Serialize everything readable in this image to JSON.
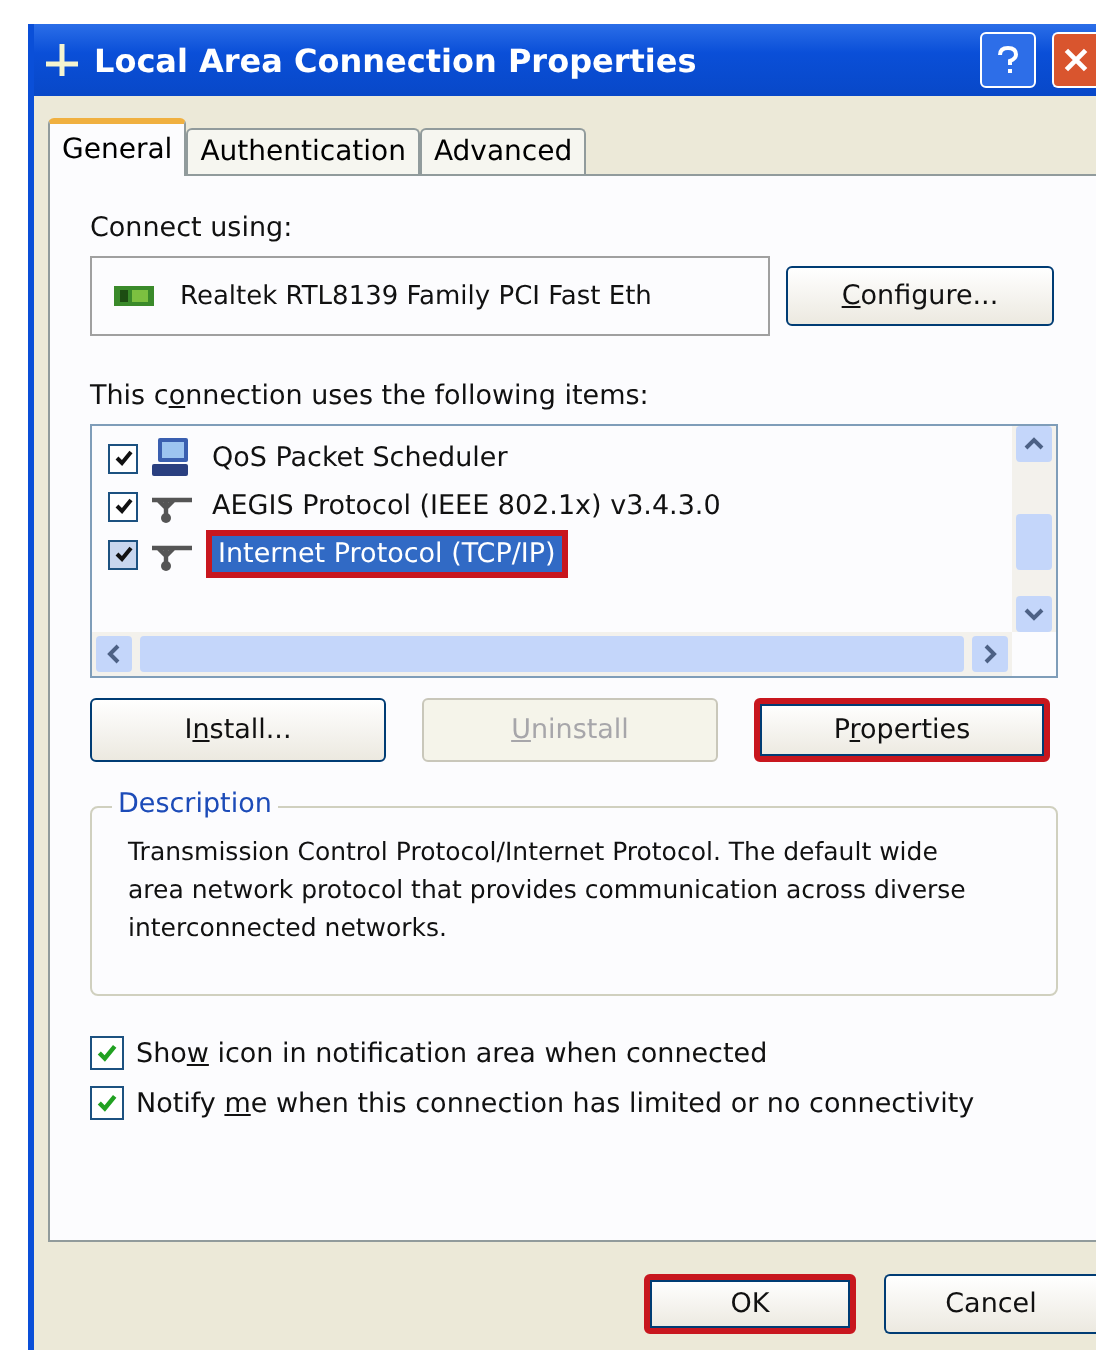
{
  "window": {
    "title": "Local Area Connection Properties"
  },
  "tabs": [
    {
      "label": "General",
      "selected": true
    },
    {
      "label": "Authentication",
      "selected": false
    },
    {
      "label": "Advanced",
      "selected": false
    }
  ],
  "connect_using": {
    "label": "Connect using:",
    "adapter": "Realtek RTL8139 Family PCI Fast Eth",
    "configure_button": {
      "key": "C",
      "after": "onfigure..."
    }
  },
  "items_label": {
    "before": "This c",
    "key": "o",
    "after": "nnection uses the following items:"
  },
  "items": [
    {
      "label": "QoS Packet Scheduler",
      "kind": "scheduler",
      "checked": true,
      "selected": false,
      "highlighted": false
    },
    {
      "label": "AEGIS Protocol (IEEE 802.1x) v3.4.3.0",
      "kind": "protocol",
      "checked": true,
      "selected": false,
      "highlighted": false
    },
    {
      "label": "Internet Protocol (TCP/IP)",
      "kind": "protocol",
      "checked": true,
      "selected": true,
      "highlighted": true
    }
  ],
  "item_buttons": [
    {
      "before": "I",
      "key": "n",
      "after": "stall...",
      "disabled": false,
      "highlighted": false
    },
    {
      "key": "U",
      "after": "ninstall",
      "disabled": true,
      "highlighted": false
    },
    {
      "before": "P",
      "key": "r",
      "after": "operties",
      "disabled": false,
      "highlighted": true
    }
  ],
  "description": {
    "title": "Description",
    "text": "Transmission Control Protocol/Internet Protocol. The default wide area network protocol that provides communication across diverse interconnected networks."
  },
  "options": [
    {
      "before": "Sho",
      "key": "w",
      "after": " icon in notification area when connected",
      "checked": true
    },
    {
      "before": "Notify ",
      "key": "m",
      "after": "e when this connection has limited or no connectivity",
      "checked": true
    }
  ],
  "buttons": [
    {
      "before": "OK",
      "highlighted": true
    },
    {
      "before": "Cancel",
      "highlighted": false
    }
  ]
}
